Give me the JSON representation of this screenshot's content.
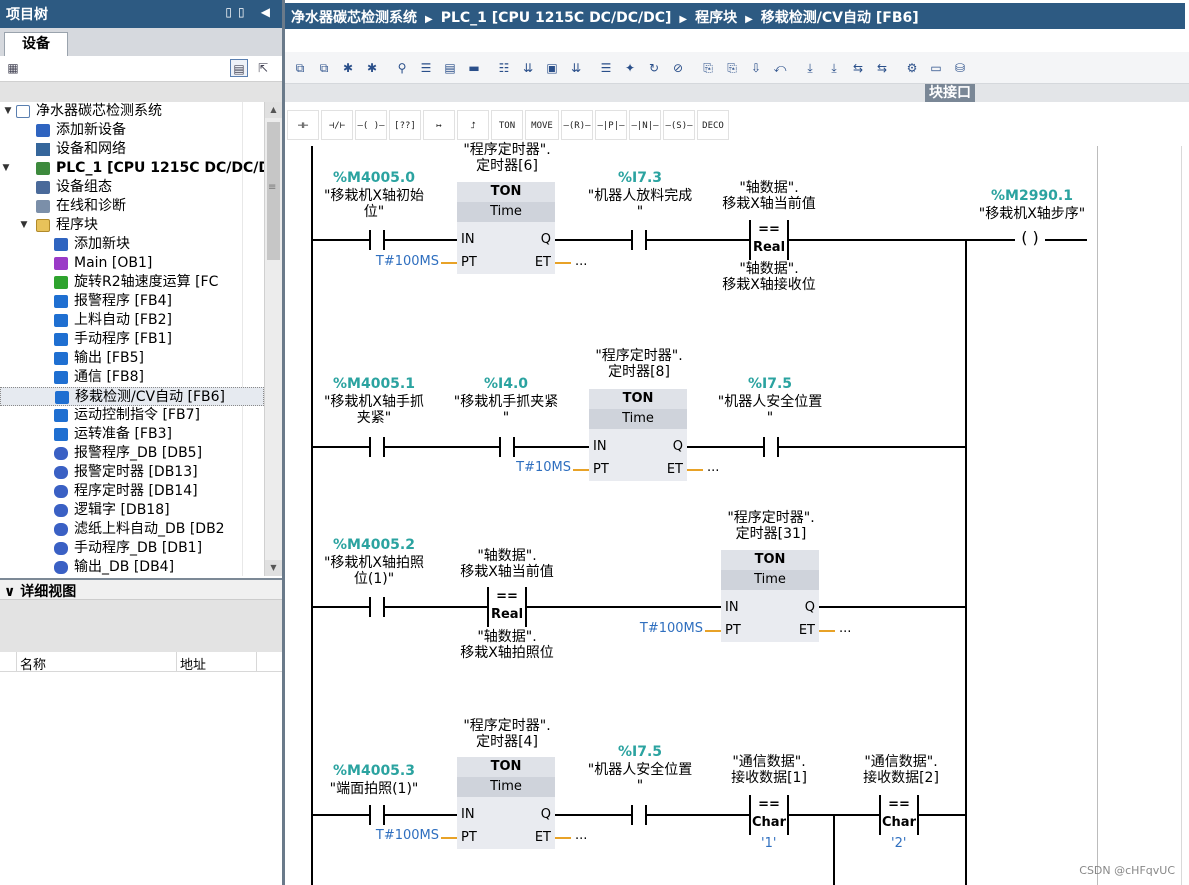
{
  "left_panel": {
    "title": "项目树",
    "title_icons": "▯▯ ◀",
    "tab": "设备",
    "tree": [
      {
        "label": "净水器碳芯检测系统",
        "toggle": "▼",
        "indent": 0,
        "icon": "doc"
      },
      {
        "label": "添加新设备",
        "indent": 1,
        "icon": "add"
      },
      {
        "label": "设备和网络",
        "indent": 1,
        "icon": "net"
      },
      {
        "label": "PLC_1 [CPU 1215C DC/DC/DC]",
        "toggle": "▼",
        "indent": 1,
        "icon": "plc",
        "bold": true
      },
      {
        "label": "设备组态",
        "indent": 2,
        "icon": "cfg"
      },
      {
        "label": "在线和诊断",
        "indent": 2,
        "icon": "diag"
      },
      {
        "label": "程序块",
        "toggle": "▼",
        "indent": 2,
        "icon": "fold"
      },
      {
        "label": "添加新块",
        "indent": 3,
        "icon": "add"
      },
      {
        "label": "Main [OB1]",
        "indent": 3,
        "icon": "ob"
      },
      {
        "label": "旋转R2轴速度运算 [FC",
        "indent": 3,
        "icon": "fc"
      },
      {
        "label": "报警程序 [FB4]",
        "indent": 3,
        "icon": "fb"
      },
      {
        "label": "上料自动 [FB2]",
        "indent": 3,
        "icon": "fb"
      },
      {
        "label": "手动程序 [FB1]",
        "indent": 3,
        "icon": "fb"
      },
      {
        "label": "输出 [FB5]",
        "indent": 3,
        "icon": "fb"
      },
      {
        "label": "通信 [FB8]",
        "indent": 3,
        "icon": "fb"
      },
      {
        "label": "移栽检测/CV自动 [FB6]",
        "indent": 3,
        "icon": "fb",
        "selected": true
      },
      {
        "label": "运动控制指令 [FB7]",
        "indent": 3,
        "icon": "fb"
      },
      {
        "label": "运转准备 [FB3]",
        "indent": 3,
        "icon": "fb"
      },
      {
        "label": "报警程序_DB [DB5]",
        "indent": 3,
        "icon": "db"
      },
      {
        "label": "报警定时器 [DB13]",
        "indent": 3,
        "icon": "db"
      },
      {
        "label": "程序定时器 [DB14]",
        "indent": 3,
        "icon": "db"
      },
      {
        "label": "逻辑字 [DB18]",
        "indent": 3,
        "icon": "db"
      },
      {
        "label": "滤纸上料自动_DB [DB2",
        "indent": 3,
        "icon": "db"
      },
      {
        "label": "手动程序_DB [DB1]",
        "indent": 3,
        "icon": "db"
      },
      {
        "label": "输出_DB [DB4]",
        "indent": 3,
        "icon": "db"
      }
    ],
    "detail_view": {
      "title": "详细视图",
      "toggle": "∨",
      "col_name": "名称",
      "col_address": "地址"
    }
  },
  "breadcrumb": [
    "净水器碳芯检测系统",
    "PLC_1 [CPU 1215C DC/DC/DC]",
    "程序块",
    "移栽检测/CV自动 [FB6]"
  ],
  "breadcrumb_sep": "▶",
  "block_interface_label": "块接口",
  "ladder_buttons": [
    "⊣⊢",
    "⊣/⊢",
    "–( )–",
    "[??]",
    "↦",
    "⮥",
    "TON",
    "MOVE",
    "–(R)–",
    "–|P|–",
    "–|N|–",
    "–(S)–",
    "DECO"
  ],
  "networks": {
    "n1": {
      "c1_addr": "%M4005.0",
      "c1_name1": "\"移栽机X轴初始",
      "c1_name2": "位\"",
      "t_db1": "\"程序定时器\".",
      "t_db2": "定时器[6]",
      "t_type": "TON",
      "t_sub": "Time",
      "pin_in": "IN",
      "pin_q": "Q",
      "pin_pt": "PT",
      "pin_et": "ET",
      "pt_val": "T#100MS",
      "et_dots": "...",
      "c2_addr": "%I7.3",
      "c2_name1": "\"机器人放料完成",
      "c2_name2": "\"",
      "cmp_top1": "\"轴数据\".",
      "cmp_top2": "移栽X轴当前值",
      "cmp_eq": "==",
      "cmp_type": "Real",
      "cmp_bot1": "\"轴数据\".",
      "cmp_bot2": "移栽X轴接收位",
      "coil_addr": "%M2990.1",
      "coil_name": "\"移栽机X轴步序\"",
      "coil": "( )"
    },
    "n2": {
      "c1_addr": "%M4005.1",
      "c1_name1": "\"移栽机X轴手抓",
      "c1_name2": "夹紧\"",
      "c2_addr": "%I4.0",
      "c2_name1": "\"移栽机手抓夹紧",
      "c2_name2": "\"",
      "t_db1": "\"程序定时器\".",
      "t_db2": "定时器[8]",
      "t_type": "TON",
      "t_sub": "Time",
      "pin_in": "IN",
      "pin_q": "Q",
      "pin_pt": "PT",
      "pin_et": "ET",
      "pt_val": "T#10MS",
      "et_dots": "...",
      "c3_addr": "%I7.5",
      "c3_name1": "\"机器人安全位置",
      "c3_name2": "\""
    },
    "n3": {
      "c1_addr": "%M4005.2",
      "c1_name1": "\"移栽机X轴拍照",
      "c1_name2": "位(1)\"",
      "cmp_top1": "\"轴数据\".",
      "cmp_top2": "移栽X轴当前值",
      "cmp_eq": "==",
      "cmp_type": "Real",
      "cmp_bot1": "\"轴数据\".",
      "cmp_bot2": "移栽X轴拍照位",
      "t_db1": "\"程序定时器\".",
      "t_db2": "定时器[31]",
      "t_type": "TON",
      "t_sub": "Time",
      "pin_in": "IN",
      "pin_q": "Q",
      "pin_pt": "PT",
      "pin_et": "ET",
      "pt_val": "T#100MS",
      "et_dots": "..."
    },
    "n4": {
      "c1_addr": "%M4005.3",
      "c1_name1": "\"端面拍照(1)\"",
      "t_db1": "\"程序定时器\".",
      "t_db2": "定时器[4]",
      "t_type": "TON",
      "t_sub": "Time",
      "pin_in": "IN",
      "pin_q": "Q",
      "pin_pt": "PT",
      "pin_et": "ET",
      "pt_val": "T#100MS",
      "et_dots": "...",
      "c2_addr": "%I7.5",
      "c2_name1": "\"机器人安全位置",
      "c2_name2": "\"",
      "cmp1_top1": "\"通信数据\".",
      "cmp1_top2": "接收数据[1]",
      "cmp1_eq": "==",
      "cmp1_type": "Char",
      "cmp1_val": "'1'",
      "cmp2_top1": "\"通信数据\".",
      "cmp2_top2": "接收数据[2]",
      "cmp2_eq": "==",
      "cmp2_type": "Char",
      "cmp2_val": "'2'"
    }
  },
  "watermark": "CSDN @cHFqvUC"
}
